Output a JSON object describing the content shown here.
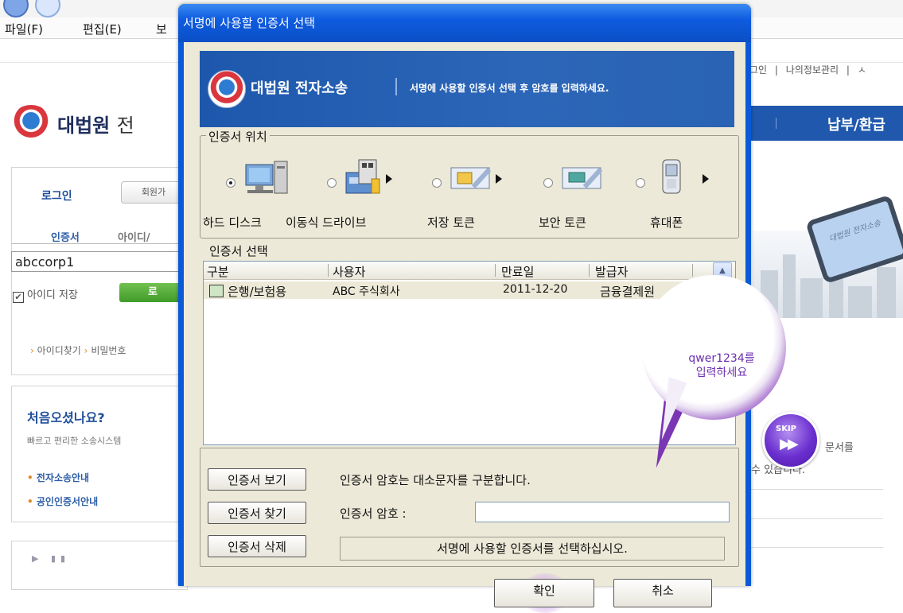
{
  "browser": {
    "menu": {
      "file": "파일(F)",
      "edit": "편집(E)",
      "view": "보"
    }
  },
  "site": {
    "top_links": [
      "그인",
      "|",
      "나의정보관리",
      "|",
      "ㅅ"
    ],
    "logo_text": "대법원",
    "logo_text2": "전",
    "nav_item": "납부/환급",
    "login": {
      "title": "로그인",
      "member_button": "회원가",
      "tab_cert": "인증서",
      "tab_id": "아이디/",
      "id_value": "abccorp1",
      "save_id_label": "아이디 저장",
      "save_id_checked": "✔",
      "login_button": "로",
      "find_id": "아이디찾기",
      "find_pw": "비밀번호"
    },
    "welcome": {
      "title": "처음오셨나요?",
      "subtitle": "빠르고 편리한 소송시스템",
      "link1": "전자소송안내",
      "link2": "공인인증서안내"
    },
    "player_icons": "▶ ▮▮",
    "sign_text": "대법원 전자소송",
    "right_text1": "문서를",
    "right_text2": "수 있습니다."
  },
  "dialog": {
    "title": "서명에 사용할 인증서 선택",
    "banner": {
      "org": "대법원 전자소송",
      "message": "서명에 사용할 인증서 선택 후 암호를 입력하세요."
    },
    "location": {
      "legend": "인증서 위치",
      "options": [
        {
          "label": "하드 디스크",
          "selected": true,
          "icon": "hard-disk-icon"
        },
        {
          "label": "이동식 드라이브",
          "selected": false,
          "icon": "removable-drive-icon"
        },
        {
          "label": "저장 토큰",
          "selected": false,
          "icon": "storage-token-icon"
        },
        {
          "label": "보안 토큰",
          "selected": false,
          "icon": "security-token-icon"
        },
        {
          "label": "휴대폰",
          "selected": false,
          "icon": "mobile-phone-icon"
        }
      ]
    },
    "cert_select": {
      "legend": "인증서 선택",
      "columns": [
        "구분",
        "사용자",
        "만료일",
        "발급자"
      ],
      "rows": [
        {
          "type": "은행/보험용",
          "user": "ABC 주식회사",
          "expiry": "2011-12-20",
          "issuer": "금융결제원"
        }
      ]
    },
    "buttons": {
      "view": "인증서 보기",
      "find": "인증서 찾기",
      "delete": "인증서 삭제",
      "ok": "확인",
      "cancel": "취소"
    },
    "case_note": "인증서 암호는 대소문자를 구분합니다.",
    "password_label": "인증서 암호 :",
    "password_value": "",
    "status": "서명에 사용할 인증서를 선택하십시오."
  },
  "bubble": {
    "line1": "qwer1234를",
    "line2": "입력하세요",
    "skip": "SKIP"
  },
  "colors": {
    "dialog_frame": "#0a5ad8",
    "dialog_body": "#ece9d8",
    "banner": "#2c66b8",
    "bubble_purple": "#7a37b3"
  }
}
